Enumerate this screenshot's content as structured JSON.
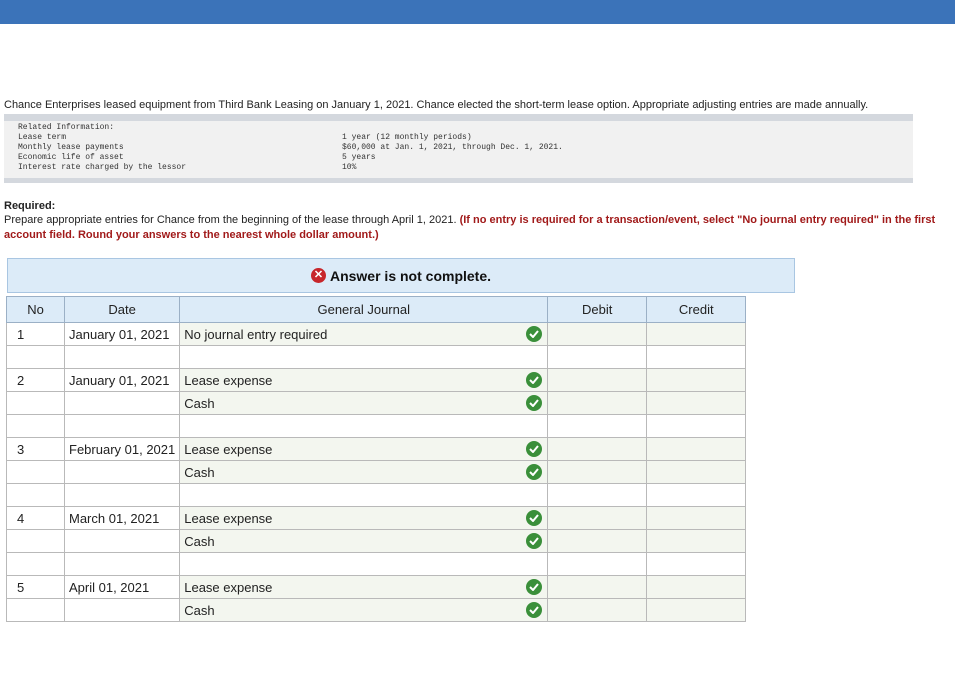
{
  "intro": "Chance Enterprises leased equipment from Third Bank Leasing on January 1, 2021. Chance elected the short-term lease option. Appropriate adjusting entries are made annually.",
  "info": {
    "heading": "Related Information:",
    "rows": [
      {
        "label": "Lease term",
        "value": "1 year (12 monthly periods)"
      },
      {
        "label": "Monthly lease payments",
        "value": "$60,000 at Jan. 1, 2021, through Dec. 1, 2021."
      },
      {
        "label": "Economic life of asset",
        "value": "5 years"
      },
      {
        "label": "Interest rate charged by the lessor",
        "value": "10%"
      }
    ]
  },
  "required": {
    "title": "Required:",
    "text": "Prepare appropriate entries for Chance from the beginning of the lease through April 1, 2021.",
    "hint": "(If no entry is required for a transaction/event, select \"No journal entry required\" in the first account field. Round your answers to the nearest whole dollar amount.)"
  },
  "status": {
    "icon": "x-circle-icon",
    "text": "Answer is not complete."
  },
  "table": {
    "headers": {
      "no": "No",
      "date": "Date",
      "journal": "General Journal",
      "debit": "Debit",
      "credit": "Credit"
    },
    "rows": [
      {
        "no": "1",
        "date": "January 01, 2021",
        "account": "No journal entry required",
        "check": true,
        "debit": "",
        "credit": ""
      },
      {
        "no": "",
        "date": "",
        "account": "",
        "check": false,
        "debit": "",
        "credit": ""
      },
      {
        "no": "2",
        "date": "January 01, 2021",
        "account": "Lease expense",
        "check": true,
        "debit": "",
        "credit": ""
      },
      {
        "no": "",
        "date": "",
        "account": "Cash",
        "check": true,
        "debit": "",
        "credit": ""
      },
      {
        "no": "",
        "date": "",
        "account": "",
        "check": false,
        "debit": "",
        "credit": ""
      },
      {
        "no": "3",
        "date": "February 01, 2021",
        "account": "Lease expense",
        "check": true,
        "debit": "",
        "credit": ""
      },
      {
        "no": "",
        "date": "",
        "account": "Cash",
        "check": true,
        "debit": "",
        "credit": ""
      },
      {
        "no": "",
        "date": "",
        "account": "",
        "check": false,
        "debit": "",
        "credit": ""
      },
      {
        "no": "4",
        "date": "March 01, 2021",
        "account": "Lease expense",
        "check": true,
        "debit": "",
        "credit": ""
      },
      {
        "no": "",
        "date": "",
        "account": "Cash",
        "check": true,
        "debit": "",
        "credit": ""
      },
      {
        "no": "",
        "date": "",
        "account": "",
        "check": false,
        "debit": "",
        "credit": ""
      },
      {
        "no": "5",
        "date": "April 01, 2021",
        "account": "Lease expense",
        "check": true,
        "debit": "",
        "credit": ""
      },
      {
        "no": "",
        "date": "",
        "account": "Cash",
        "check": true,
        "debit": "",
        "credit": ""
      }
    ]
  },
  "colors": {
    "topbar": "#3b73b9",
    "check": "#3a8f3a",
    "error": "#c7262b",
    "hint": "#a11a1a"
  }
}
